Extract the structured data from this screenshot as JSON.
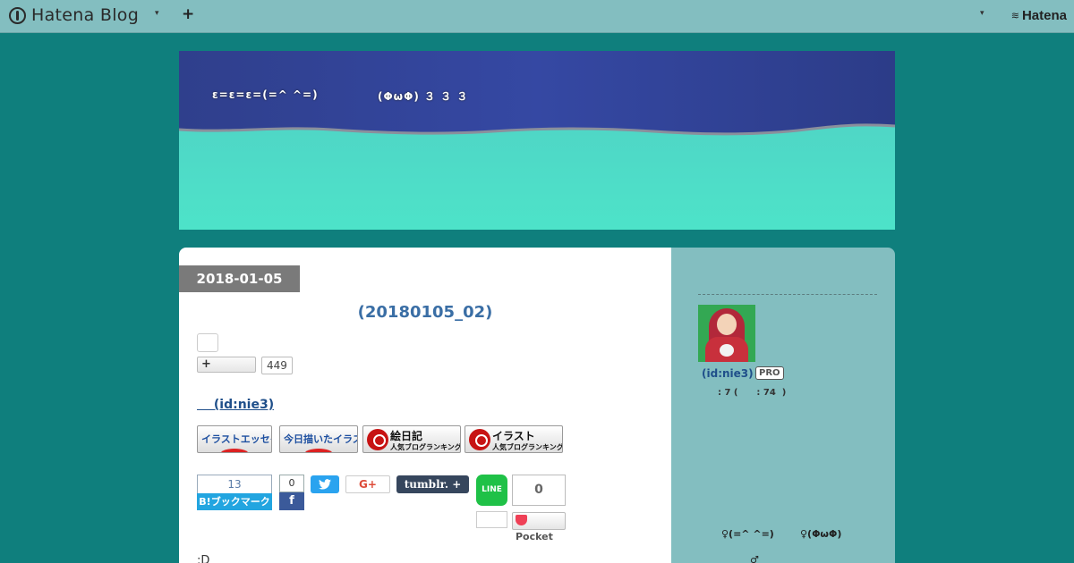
{
  "topbar": {
    "brand": "Hatena Blog",
    "caret": "▾",
    "plus": "+",
    "right_caret": "▾",
    "right_brand": "Hatena"
  },
  "banner": {
    "text_left": "ε=ε=ε=(=^ ^=)",
    "text_right": "(ΦωΦ) ３ ３ ３"
  },
  "entry": {
    "date": "2018-01-05",
    "title": "(20180105_02)",
    "add_label": "+",
    "add_count": "449",
    "author": "　 (id:nie3)",
    "rank_buttons": [
      {
        "label": "イラストエッセイ"
      },
      {
        "label": "今日描いたイラスト"
      },
      {
        "main": "絵日記",
        "sub": "人気ブログランキング"
      },
      {
        "main": "イラスト",
        "sub": "人気ブログランキング"
      }
    ],
    "share": {
      "hatebu_count": "13",
      "hatebu_label": "B!ブックマーク",
      "facebook_count": "0",
      "facebook_icon": "f",
      "twitter_icon": "🐦",
      "gplus_label": "G+",
      "tumblr_label": "tumblr. +",
      "line_label": "LINE",
      "pocket_count": "0",
      "pocket_label": "Pocket"
    },
    "body_start": ":D"
  },
  "sidebar": {
    "user": "(id:nie3)",
    "pro": "PRO",
    "stats": ": 7 (      : 74  )",
    "nick1": "♀(=^ ^=)",
    "nick2": "♀(ΦωΦ)",
    "sym": "♂"
  }
}
